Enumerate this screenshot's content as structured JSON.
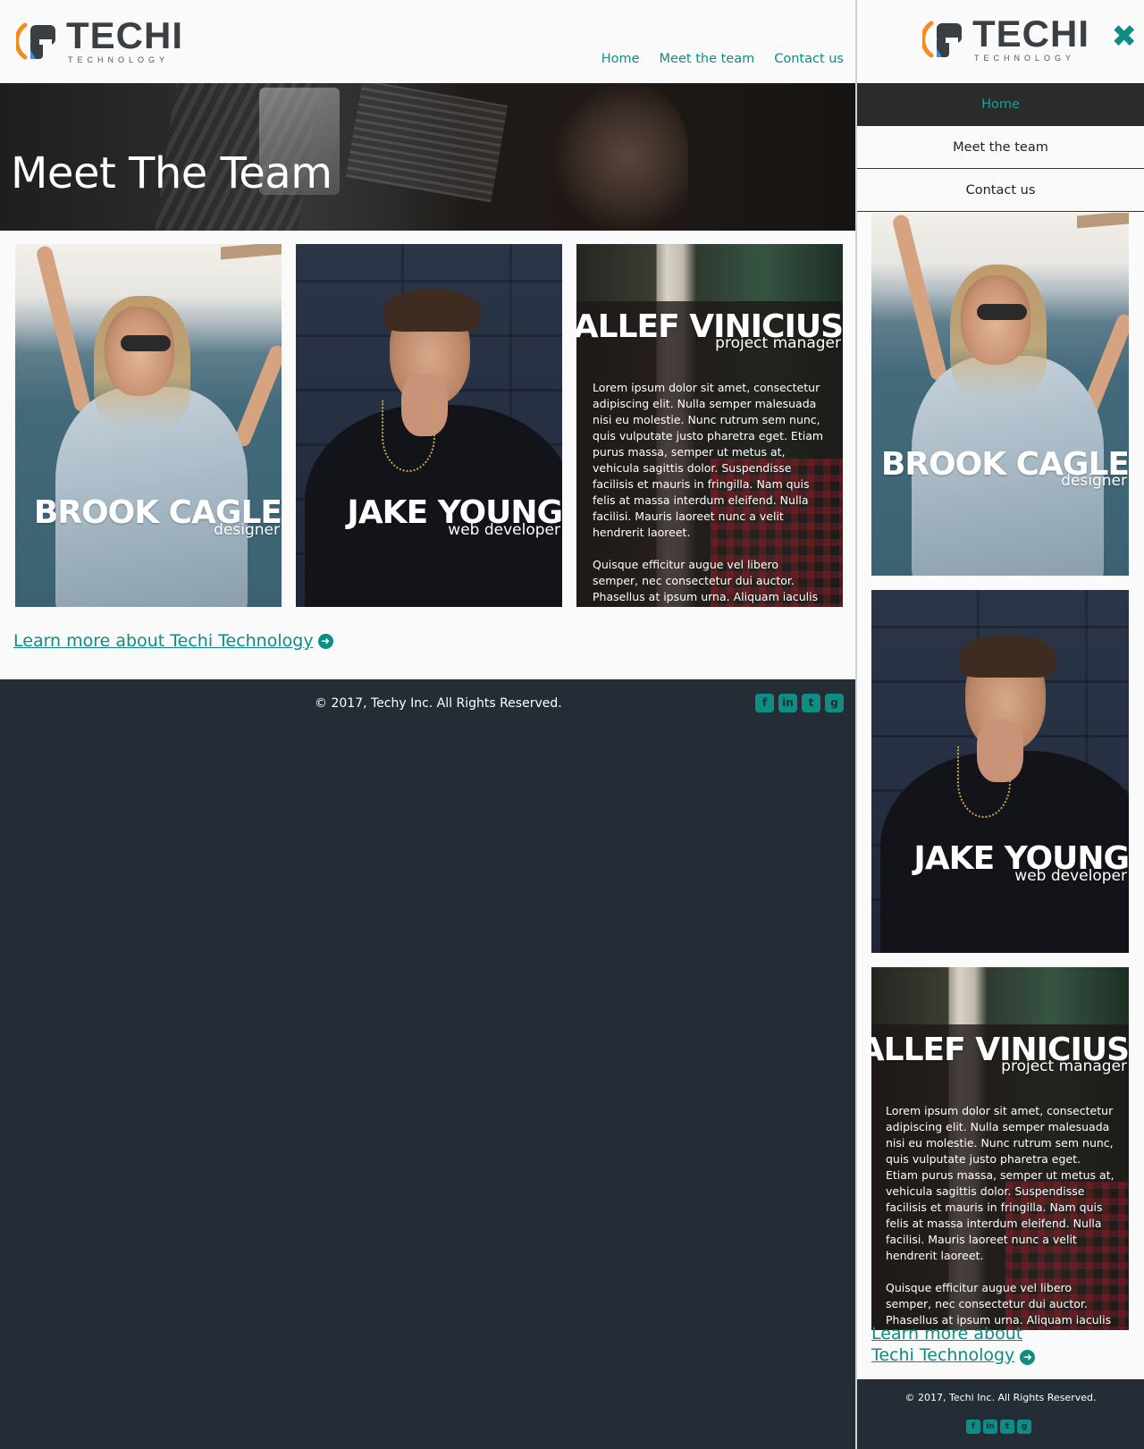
{
  "brand": {
    "name": "TECHI",
    "tagline": "TECHNOLOGY",
    "colors": {
      "accent": "#0f8c83",
      "logo_orange": "#f28c1e",
      "logo_blue": "#3b8fe0",
      "footer_bg": "#242d35"
    }
  },
  "nav": {
    "items": [
      "Home",
      "Meet the team",
      "Contact us"
    ]
  },
  "hero": {
    "title": "Meet The Team"
  },
  "team": [
    {
      "name": "BROOK CAGLE",
      "role": "designer"
    },
    {
      "name": "JAKE YOUNG",
      "role": "web developer"
    },
    {
      "name": "ALLEF VINICIUS",
      "role": "project manager",
      "bio": [
        "Lorem ipsum dolor sit amet, consectetur adipiscing elit. Nulla semper malesuada nisi eu molestie. Nunc rutrum sem nunc, quis vulputate justo pharetra eget. Etiam purus massa, semper ut metus at, vehicula sagittis dolor. Suspendisse facilisis et mauris in fringilla. Nam quis felis at massa interdum eleifend. Nulla facilisi. Mauris laoreet nunc a velit hendrerit laoreet.",
        "Quisque efficitur augue vel libero semper, nec consectetur dui auctor. Phasellus at ipsum urna. Aliquam iaculis est sit amet"
      ]
    }
  ],
  "learn_more": {
    "label": "Learn more about Techi Technology",
    "line1": "Learn more about ",
    "line2": "Techi Technology",
    "icon": "arrow-circle-right-icon"
  },
  "footer": {
    "desktop_copyright": "© 2017, Techy Inc. All Rights Reserved.",
    "mobile_copyright": "© 2017, Techi Inc. All Rights Reserved.",
    "socials": [
      {
        "icon": "facebook-icon",
        "glyph": "f"
      },
      {
        "icon": "linkedin-icon",
        "glyph": "in"
      },
      {
        "icon": "twitter-icon",
        "glyph": "t"
      },
      {
        "icon": "github-icon",
        "glyph": "g"
      }
    ]
  },
  "mobile_menu": {
    "close_icon": "close-icon",
    "active_item": "Home"
  }
}
